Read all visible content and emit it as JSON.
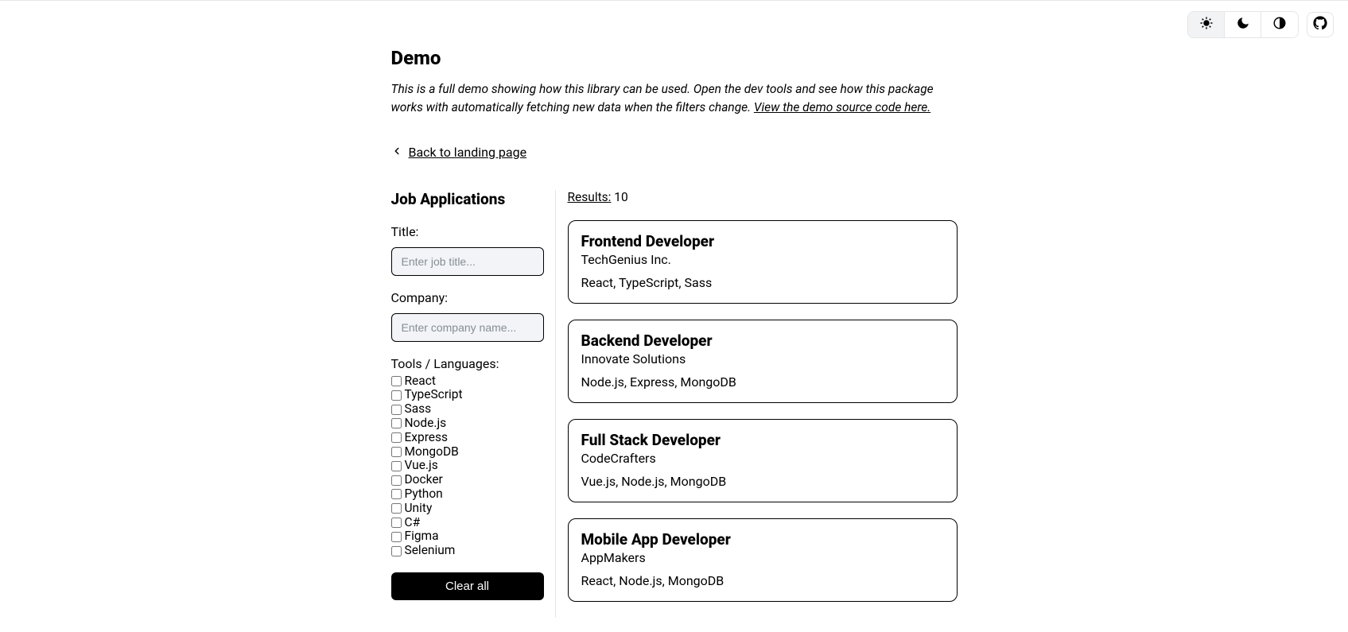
{
  "header": {
    "title": "Demo",
    "description_prefix": "This is a full demo showing how this library can be used. Open the dev tools and see how this package works with automatically fetching new data when the filters change. ",
    "source_link_text": "View the demo source code here.",
    "back_link_text": "Back to landing page"
  },
  "sidebar": {
    "heading": "Job Applications",
    "title_label": "Title:",
    "title_placeholder": "Enter job title...",
    "company_label": "Company:",
    "company_placeholder": "Enter company name...",
    "tools_label": "Tools / Languages:",
    "tools": [
      "React",
      "TypeScript",
      "Sass",
      "Node.js",
      "Express",
      "MongoDB",
      "Vue.js",
      "Docker",
      "Python",
      "Unity",
      "C#",
      "Figma",
      "Selenium"
    ],
    "clear_label": "Clear all"
  },
  "results": {
    "label": "Results:",
    "count": "10",
    "jobs": [
      {
        "title": "Frontend Developer",
        "company": "TechGenius Inc.",
        "skills": "React, TypeScript, Sass"
      },
      {
        "title": "Backend Developer",
        "company": "Innovate Solutions",
        "skills": "Node.js, Express, MongoDB"
      },
      {
        "title": "Full Stack Developer",
        "company": "CodeCrafters",
        "skills": "Vue.js, Node.js, MongoDB"
      },
      {
        "title": "Mobile App Developer",
        "company": "AppMakers",
        "skills": "React, Node.js, MongoDB"
      }
    ]
  }
}
